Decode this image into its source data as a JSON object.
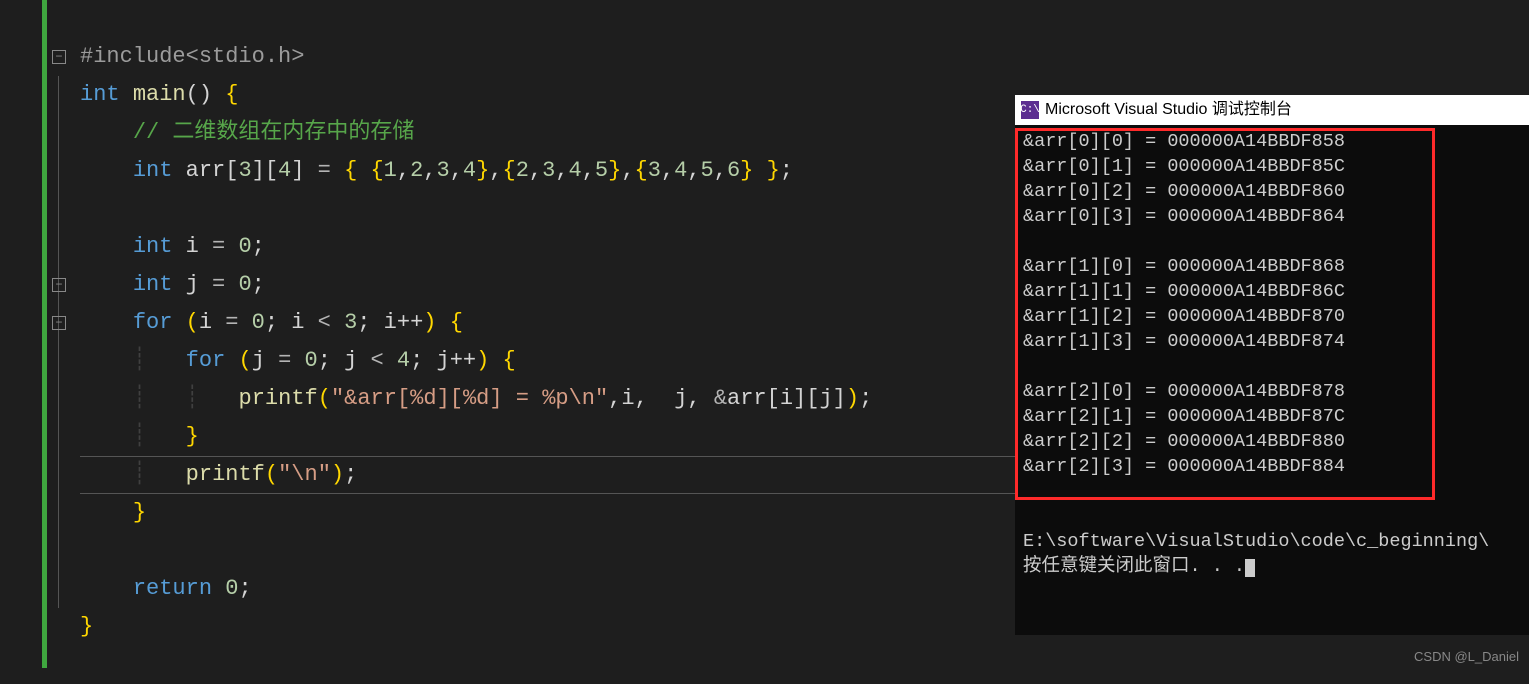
{
  "code": {
    "l1_pp": "#include",
    "l1_inc": "<stdio.h>",
    "l2_kw1": "int",
    "l2_fn": "main",
    "l3_cm": "// 二维数组在内存中的存储",
    "l4_kw": "int",
    "l4_id": "arr",
    "l4_dim1": "3",
    "l4_dim2": "4",
    "l4_vals": "{1,2,3,4},{2,3,4,5},{3,4,5,6}",
    "l6_kw": "int",
    "l6_id": "i",
    "l6_val": "0",
    "l7_kw": "int",
    "l7_id": "j",
    "l7_val": "0",
    "l8_kw": "for",
    "l8_init_id": "i",
    "l8_init_val": "0",
    "l8_cond_id": "i",
    "l8_cond_val": "3",
    "l8_inc": "i++",
    "l9_kw": "for",
    "l9_init_id": "j",
    "l9_init_val": "0",
    "l9_cond_id": "j",
    "l9_cond_val": "4",
    "l9_inc": "j++",
    "l10_fn": "printf",
    "l10_str": "\"&arr[%d][%d] = %p\\n\"",
    "l10_a1": "i",
    "l10_a2": "j",
    "l10_a3": "&arr[i][j]",
    "l12_fn": "printf",
    "l12_str": "\"\\n\"",
    "l15_kw": "return",
    "l15_val": "0"
  },
  "console": {
    "title": "Microsoft Visual Studio 调试控制台",
    "icon_text": "C:\\",
    "lines": [
      "&arr[0][0] = 000000A14BBDF858",
      "&arr[0][1] = 000000A14BBDF85C",
      "&arr[0][2] = 000000A14BBDF860",
      "&arr[0][3] = 000000A14BBDF864",
      "",
      "&arr[1][0] = 000000A14BBDF868",
      "&arr[1][1] = 000000A14BBDF86C",
      "&arr[1][2] = 000000A14BBDF870",
      "&arr[1][3] = 000000A14BBDF874",
      "",
      "&arr[2][0] = 000000A14BBDF878",
      "&arr[2][1] = 000000A14BBDF87C",
      "&arr[2][2] = 000000A14BBDF880",
      "&arr[2][3] = 000000A14BBDF884",
      "",
      "",
      "E:\\software\\VisualStudio\\code\\c_beginning\\",
      "按任意键关闭此窗口. . ."
    ]
  },
  "watermark": "CSDN @L_Daniel",
  "fold": {
    "minus": "−"
  }
}
